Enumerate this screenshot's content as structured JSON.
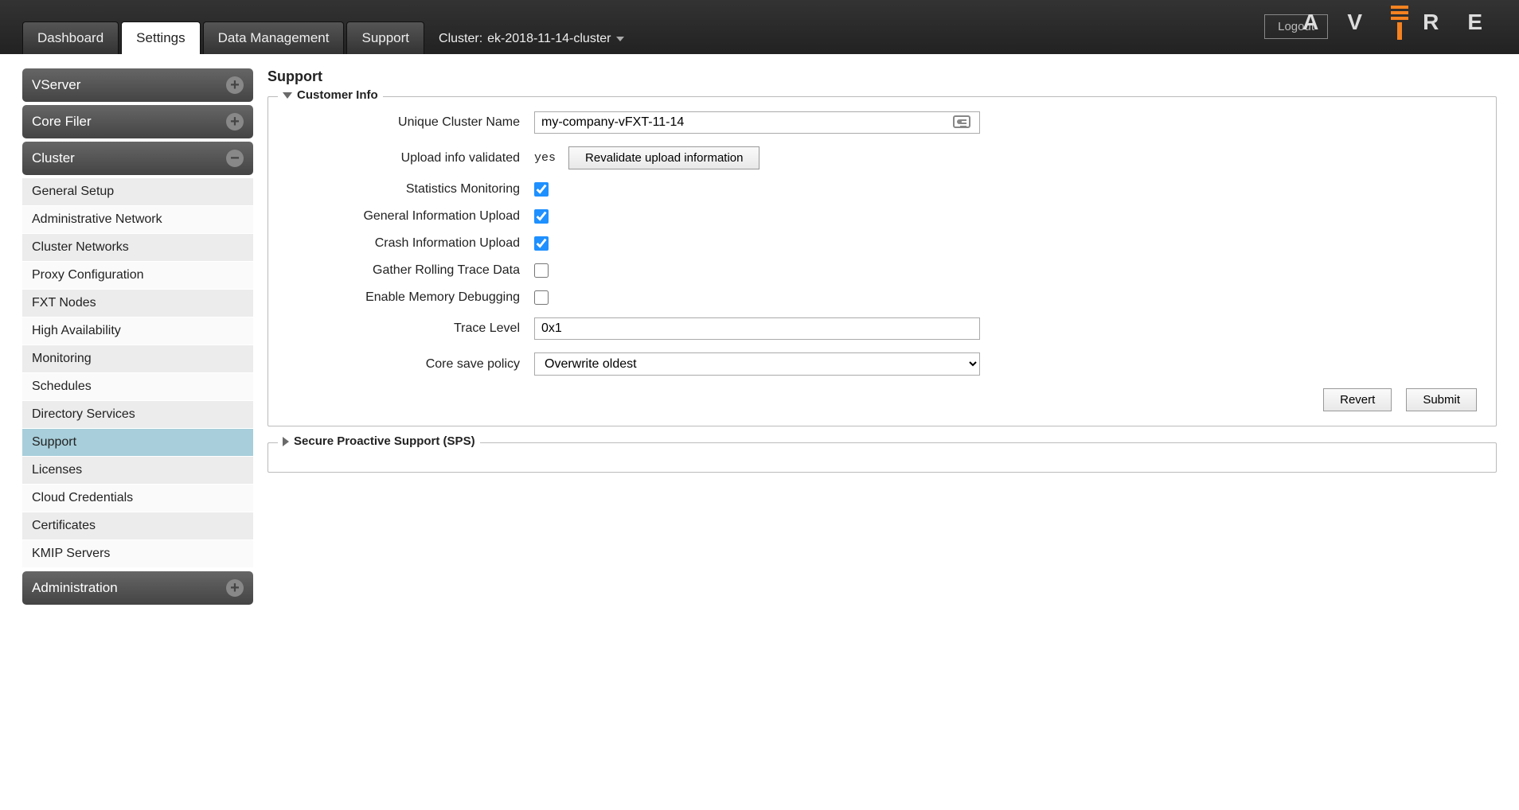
{
  "topbar": {
    "tabs": [
      {
        "label": "Dashboard"
      },
      {
        "label": "Settings"
      },
      {
        "label": "Data Management"
      },
      {
        "label": "Support"
      }
    ],
    "cluster_prefix": "Cluster: ",
    "cluster_name": "ek-2018-11-14-cluster",
    "logout": "Logout",
    "logo_text": "AVERE"
  },
  "sidebar": {
    "sections": [
      {
        "title": "VServer",
        "expanded": false,
        "items": []
      },
      {
        "title": "Core Filer",
        "expanded": false,
        "items": []
      },
      {
        "title": "Cluster",
        "expanded": true,
        "items": [
          "General Setup",
          "Administrative Network",
          "Cluster Networks",
          "Proxy Configuration",
          "FXT Nodes",
          "High Availability",
          "Monitoring",
          "Schedules",
          "Directory Services",
          "Support",
          "Licenses",
          "Cloud Credentials",
          "Certificates",
          "KMIP Servers"
        ],
        "selected_index": 9
      },
      {
        "title": "Administration",
        "expanded": false,
        "items": []
      }
    ]
  },
  "main": {
    "page_title": "Support",
    "customer_info": {
      "legend": "Customer Info",
      "unique_cluster_name_label": "Unique Cluster Name",
      "unique_cluster_name_value": "my-company-vFXT-11-14",
      "upload_info_validated_label": "Upload info validated",
      "upload_info_validated_value": "yes",
      "revalidate_button": "Revalidate upload information",
      "statistics_monitoring_label": "Statistics Monitoring",
      "statistics_monitoring_checked": true,
      "general_info_upload_label": "General Information Upload",
      "general_info_upload_checked": true,
      "crash_info_upload_label": "Crash Information Upload",
      "crash_info_upload_checked": true,
      "gather_rolling_trace_label": "Gather Rolling Trace Data",
      "gather_rolling_trace_checked": false,
      "enable_memory_debugging_label": "Enable Memory Debugging",
      "enable_memory_debugging_checked": false,
      "trace_level_label": "Trace Level",
      "trace_level_value": "0x1",
      "core_save_policy_label": "Core save policy",
      "core_save_policy_value": "Overwrite oldest",
      "revert_button": "Revert",
      "submit_button": "Submit"
    },
    "sps": {
      "legend": "Secure Proactive Support (SPS)"
    }
  }
}
